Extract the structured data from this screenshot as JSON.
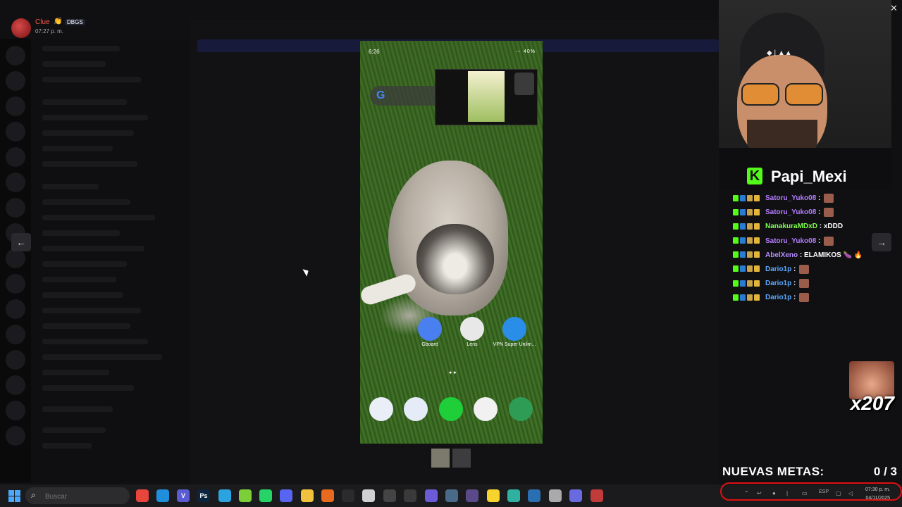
{
  "message": {
    "author": "Clue",
    "author_emoji": "👏",
    "badge": "DBGS",
    "time": "07:27 p. m."
  },
  "viewer": {
    "prev_label": "←",
    "next_label": "→",
    "close_label": "✕"
  },
  "phone": {
    "status_time": "6:26",
    "status_icons": "⋯ 40%",
    "google_letter": "G",
    "apps": [
      {
        "label": "Gboard",
        "icon": "gboard-icon",
        "color": "#4a7ff0"
      },
      {
        "label": "Lens",
        "icon": "lens-icon",
        "color": "#e8e8e8"
      },
      {
        "label": "VPN Super Unlim...",
        "icon": "vpn-key-icon",
        "color": "#2a8ee8"
      }
    ],
    "dock": [
      {
        "icon": "phone-icon",
        "color": "#e9eef7"
      },
      {
        "icon": "messages-icon",
        "color": "#e6ecf7"
      },
      {
        "icon": "b-app-icon",
        "color": "#1ecf3a"
      },
      {
        "icon": "chrome-icon",
        "color": "#f1f1f1"
      },
      {
        "icon": "leaf-app-icon",
        "color": "#2f9c56"
      }
    ],
    "page_indicator": "● ●"
  },
  "stream": {
    "streamer_name": "Papi_Mexi",
    "chat": [
      {
        "user": "Satoru_Yuko08",
        "color": "#b57cff",
        "msg": "",
        "emote": true
      },
      {
        "user": "Satoru_Yuko08",
        "color": "#b57cff",
        "msg": "",
        "emote": true
      },
      {
        "user": "NanakuraMDxD",
        "color": "#7dff4d",
        "msg": "xDDD",
        "emote": false
      },
      {
        "user": "Satoru_Yuko08",
        "color": "#b57cff",
        "msg": "",
        "emote": true
      },
      {
        "user": "AbelXeno",
        "color": "#b68dff",
        "msg": "ELAMIKOS 🍆 🔥",
        "emote": false
      },
      {
        "user": "Dario1p",
        "color": "#5aa8ff",
        "msg": "",
        "emote": true
      },
      {
        "user": "Dario1p",
        "color": "#5aa8ff",
        "msg": "",
        "emote": true
      },
      {
        "user": "Dario1p",
        "color": "#5aa8ff",
        "msg": "",
        "emote": true
      }
    ],
    "combo_count": "x207",
    "goals_label": "NUEVAS METAS:",
    "goals_value": "0 / 3"
  },
  "taskbar": {
    "search_placeholder": "Buscar",
    "apps": [
      {
        "icon": "chrome-icon",
        "text": "",
        "color": "#e8453c"
      },
      {
        "icon": "edge-icon",
        "text": "",
        "color": "#1f8fdc"
      },
      {
        "icon": "vivaldi-icon",
        "text": "V",
        "color": "#5b5bd6"
      },
      {
        "icon": "photoshop-icon",
        "text": "Ps",
        "color": "#0b2540"
      },
      {
        "icon": "telegram-icon",
        "text": "",
        "color": "#2aa3e0"
      },
      {
        "icon": "android-icon",
        "text": "",
        "color": "#7dcf3a"
      },
      {
        "icon": "whatsapp-icon",
        "text": "",
        "color": "#25d366"
      },
      {
        "icon": "discord-icon",
        "text": "",
        "color": "#5865f2"
      },
      {
        "icon": "file-explorer-icon",
        "text": "",
        "color": "#f3c23c"
      },
      {
        "icon": "firefox-icon",
        "text": "",
        "color": "#e86a1f"
      },
      {
        "icon": "obs-icon",
        "text": "",
        "color": "#2b2b2b"
      },
      {
        "icon": "editor-icon",
        "text": "",
        "color": "#d0d0d0"
      },
      {
        "icon": "audio-icon",
        "text": "",
        "color": "#444"
      },
      {
        "icon": "steam-icon",
        "text": "",
        "color": "#3a3a3a"
      },
      {
        "icon": "cortana-icon",
        "text": "",
        "color": "#6b5bd6"
      },
      {
        "icon": "image-app-icon",
        "text": "",
        "color": "#4a6a8a"
      },
      {
        "icon": "streamdeck-icon",
        "text": "",
        "color": "#5a4a8a"
      },
      {
        "icon": "sticky-notes-icon",
        "text": "",
        "color": "#f6d32d"
      },
      {
        "icon": "gaming-app-icon",
        "text": "",
        "color": "#2fb0a0"
      },
      {
        "icon": "steelseries-icon",
        "text": "",
        "color": "#2b6fb3"
      },
      {
        "icon": "launcher-icon",
        "text": "",
        "color": "#aaa"
      },
      {
        "icon": "proton-icon",
        "text": "",
        "color": "#6a6ae0"
      },
      {
        "icon": "valorant-icon",
        "text": "",
        "color": "#c23b3b"
      }
    ],
    "tray_language": "ESP",
    "clock_time": "07:30 p. m.",
    "clock_date": "04/11/2025"
  },
  "colors": {
    "kick_green": "#53fc18",
    "tray_highlight": "#e01010"
  }
}
